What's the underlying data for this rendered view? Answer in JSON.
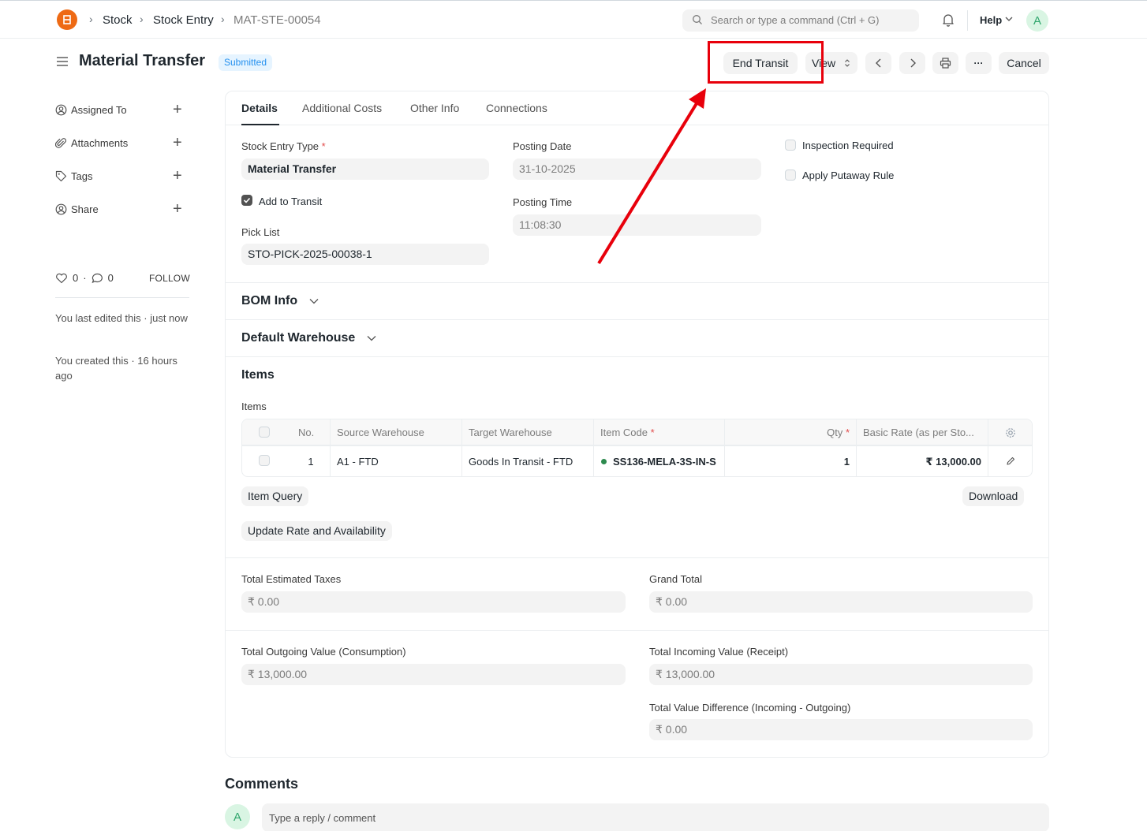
{
  "navbar": {
    "logo_text": "ERP",
    "breadcrumbs": [
      "Stock",
      "Stock Entry",
      "MAT-STE-00054"
    ],
    "search_placeholder": "Search or type a command (Ctrl + G)",
    "help_label": "Help",
    "avatar_initial": "A"
  },
  "page": {
    "title": "Material Transfer",
    "status": "Submitted",
    "actions": {
      "end_transit": "End Transit",
      "view": "View",
      "more": "···",
      "cancel": "Cancel"
    }
  },
  "sidebar": {
    "items": [
      {
        "label": "Assigned To"
      },
      {
        "label": "Attachments"
      },
      {
        "label": "Tags"
      },
      {
        "label": "Share"
      }
    ],
    "likes": "0",
    "comments_count": "0",
    "follow_label": "FOLLOW",
    "last_edited": "You last edited this · just now",
    "created": "You created this · 16 hours ago"
  },
  "tabs": [
    "Details",
    "Additional Costs",
    "Other Info",
    "Connections"
  ],
  "form": {
    "stock_entry_type_label": "Stock Entry Type",
    "stock_entry_type": "Material Transfer",
    "add_to_transit_label": "Add to Transit",
    "pick_list_label": "Pick List",
    "pick_list": "STO-PICK-2025-00038-1",
    "posting_date_label": "Posting Date",
    "posting_date": "31-10-2025",
    "posting_time_label": "Posting Time",
    "posting_time": "11:08:30",
    "inspection_required_label": "Inspection Required",
    "apply_putaway_label": "Apply Putaway Rule"
  },
  "sections": {
    "bom_info": "BOM Info",
    "default_warehouse": "Default Warehouse",
    "items": "Items"
  },
  "items_table": {
    "field_label": "Items",
    "columns": [
      "No.",
      "Source Warehouse",
      "Target Warehouse",
      "Item Code",
      "Qty",
      "Basic Rate (as per Sto..."
    ],
    "rows": [
      {
        "no": "1",
        "source": "A1 - FTD",
        "target": "Goods In Transit - FTD",
        "item_code": "SS136-MELA-3S-IN-S",
        "qty": "1",
        "rate": "₹ 13,000.00"
      }
    ],
    "item_query_label": "Item Query",
    "download_label": "Download",
    "update_rate_label": "Update Rate and Availability"
  },
  "totals": {
    "est_taxes_label": "Total Estimated Taxes",
    "est_taxes": "₹ 0.00",
    "grand_total_label": "Grand Total",
    "grand_total": "₹ 0.00",
    "outgoing_label": "Total Outgoing Value (Consumption)",
    "outgoing": "₹ 13,000.00",
    "incoming_label": "Total Incoming Value (Receipt)",
    "incoming": "₹ 13,000.00",
    "difference_label": "Total Value Difference (Incoming - Outgoing)",
    "difference": "₹ 0.00"
  },
  "comments": {
    "title": "Comments",
    "placeholder": "Type a reply / comment",
    "avatar_initial": "A"
  },
  "colors": {
    "annotation": "#e8000b",
    "status_badge": "#2490ef",
    "logo": "#ee6a14",
    "in_stock_dot": "#2d8a4e"
  }
}
